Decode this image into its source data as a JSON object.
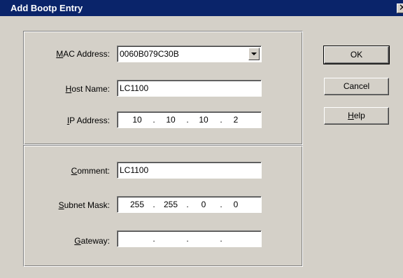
{
  "window": {
    "title": "Add Bootp Entry",
    "close_glyph": "✕"
  },
  "form": {
    "mac_address": {
      "label_prefix": "",
      "label_mnemonic": "M",
      "label_rest": "AC Address:",
      "value": "0060B079C30B"
    },
    "host_name": {
      "label_prefix": "",
      "label_mnemonic": "H",
      "label_rest": "ost Name:",
      "value": "LC1100"
    },
    "ip_address": {
      "label_prefix": "",
      "label_mnemonic": "I",
      "label_rest": "P Address:",
      "octets": [
        "10",
        "10",
        "10",
        "2"
      ]
    },
    "comment": {
      "label_prefix": "",
      "label_mnemonic": "C",
      "label_rest": "omment:",
      "value": "LC1100"
    },
    "subnet_mask": {
      "label_prefix": "",
      "label_mnemonic": "S",
      "label_rest": "ubnet Mask:",
      "octets": [
        "255",
        "255",
        "0",
        "0"
      ]
    },
    "gateway": {
      "label_prefix": "",
      "label_mnemonic": "G",
      "label_rest": "ateway:",
      "octets": [
        "",
        "",
        "",
        ""
      ]
    }
  },
  "buttons": {
    "ok": "OK",
    "cancel": "Cancel",
    "help_mnemonic": "H",
    "help_rest": "elp"
  },
  "ip_dot": "."
}
